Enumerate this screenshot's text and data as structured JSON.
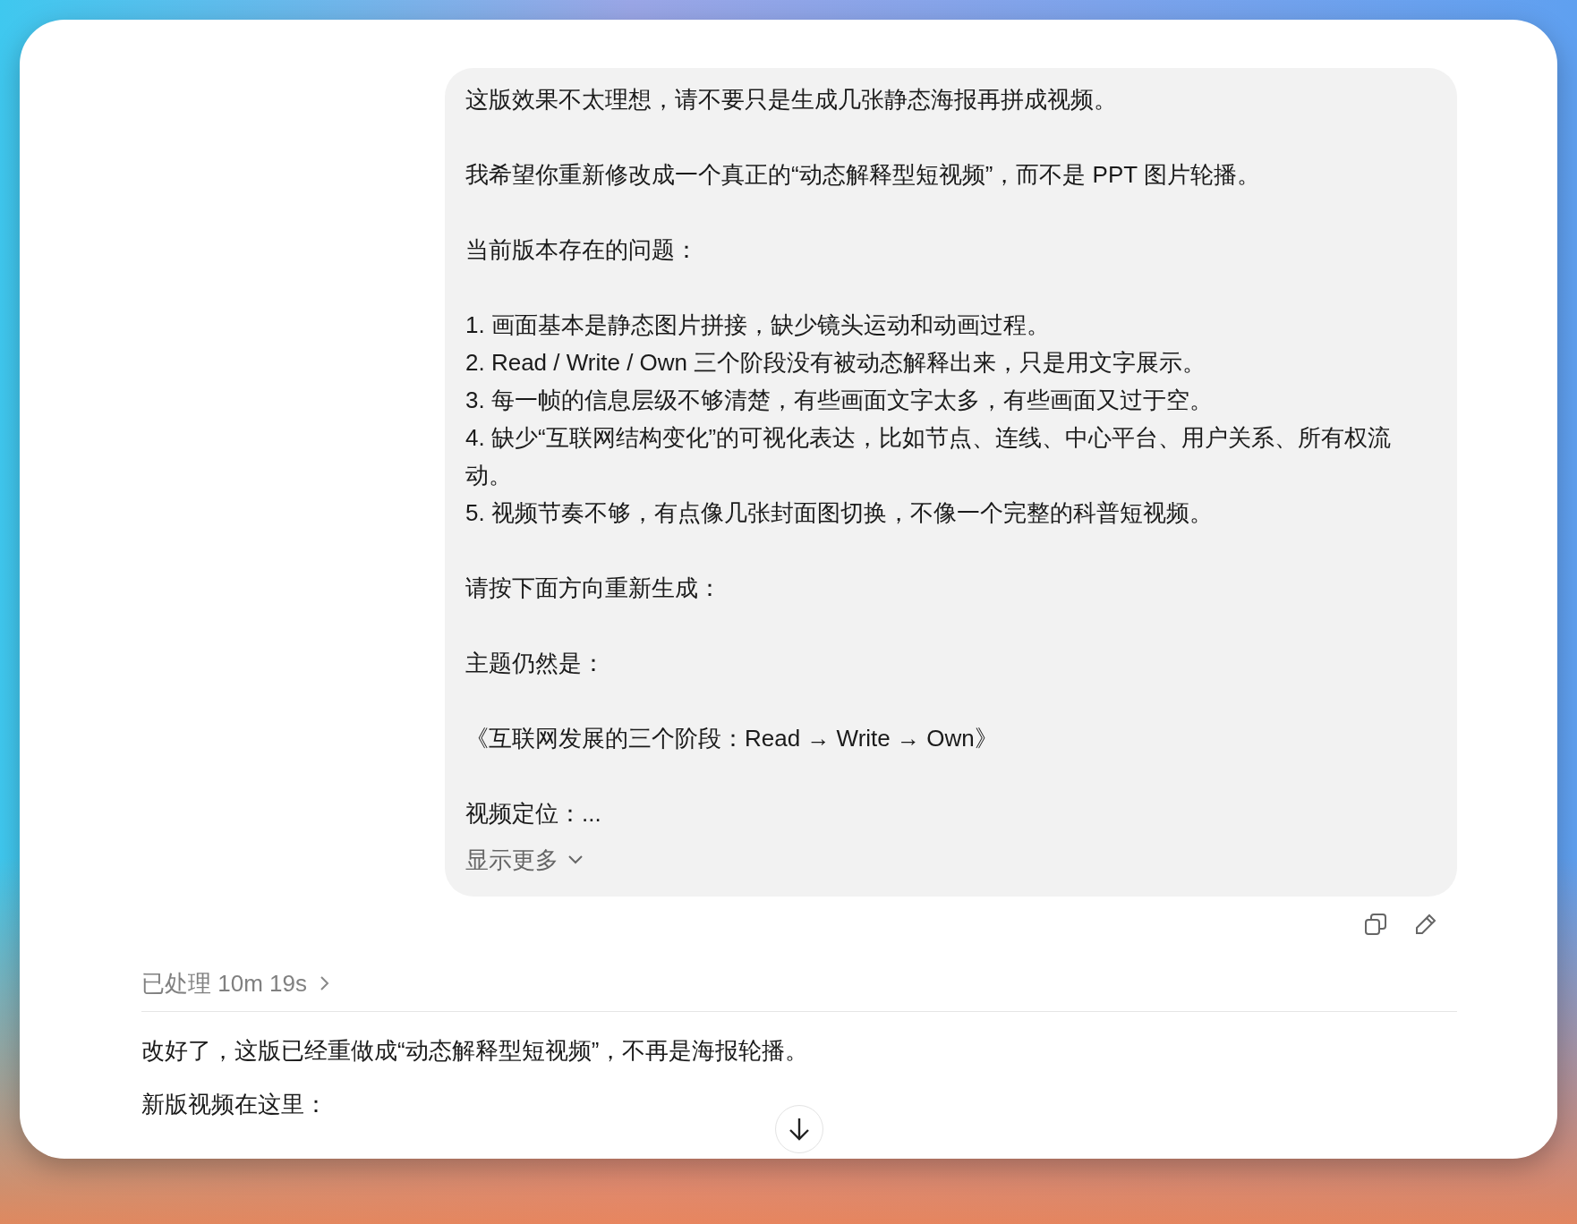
{
  "user_message": {
    "blocks": [
      {
        "kind": "paragraph",
        "text": "这版效果不太理想，请不要只是生成几张静态海报再拼成视频。"
      },
      {
        "kind": "paragraph",
        "text": "我希望你重新修改成一个真正的“动态解释型短视频”，而不是 PPT 图片轮播。"
      },
      {
        "kind": "paragraph",
        "text": "当前版本存在的问题："
      },
      {
        "kind": "list",
        "items": [
          "1. 画面基本是静态图片拼接，缺少镜头运动和动画过程。",
          "2. Read / Write / Own 三个阶段没有被动态解释出来，只是用文字展示。",
          "3. 每一帧的信息层级不够清楚，有些画面文字太多，有些画面又过于空。",
          "4. 缺少“互联网结构变化”的可视化表达，比如节点、连线、中心平台、用户关系、所有权流动。",
          "5. 视频节奏不够，有点像几张封面图切换，不像一个完整的科普短视频。"
        ]
      },
      {
        "kind": "paragraph",
        "text": "请按下面方向重新生成："
      },
      {
        "kind": "paragraph",
        "text": "主题仍然是："
      },
      {
        "kind": "paragraph",
        "text": "《互联网发展的三个阶段：Read → Write → Own》"
      },
      {
        "kind": "paragraph",
        "text": "视频定位：..."
      }
    ],
    "show_more": "显示更多"
  },
  "processed": {
    "label": "已处理 10m 19s"
  },
  "reply": {
    "lines": [
      "改好了，这版已经重做成“动态解释型短视频”，不再是海报轮播。",
      "新版视频在这里："
    ]
  }
}
